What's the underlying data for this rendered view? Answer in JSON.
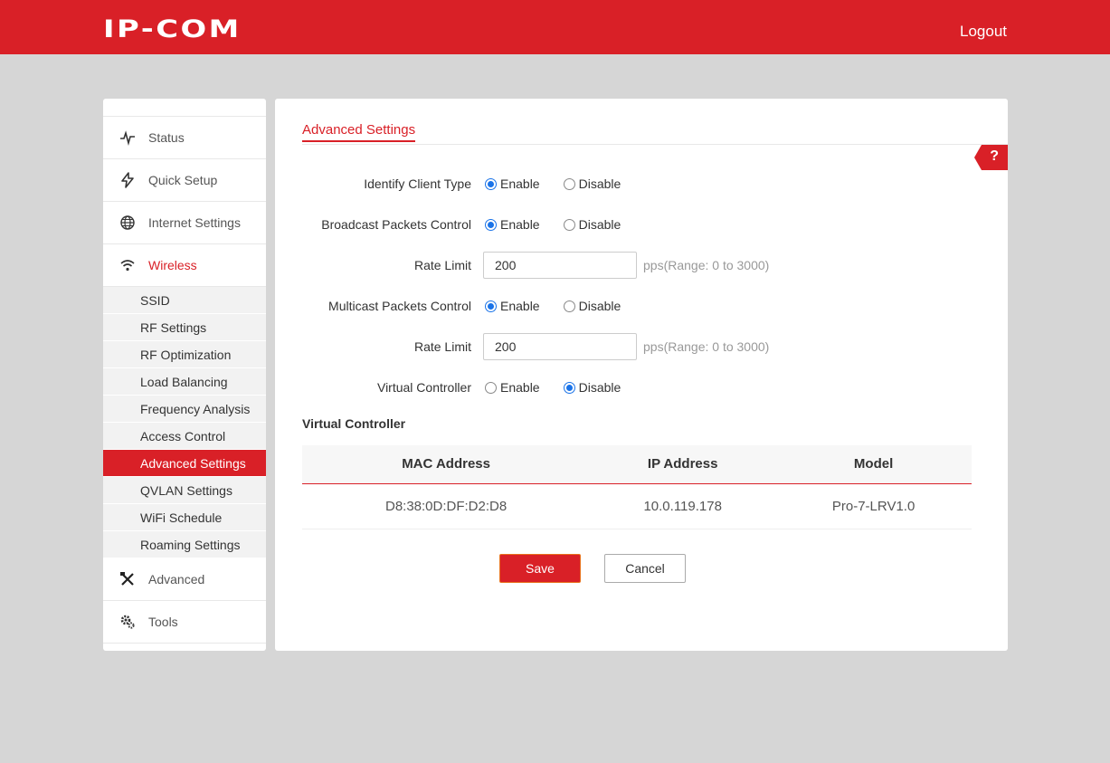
{
  "header": {
    "logo": "IP-COM",
    "logout": "Logout"
  },
  "colors": {
    "brand": "#d92027",
    "radio_selected": "#1a73e8"
  },
  "sidebar": {
    "items": [
      {
        "label": "Status",
        "icon": "pulse-icon"
      },
      {
        "label": "Quick Setup",
        "icon": "lightning-icon"
      },
      {
        "label": "Internet Settings",
        "icon": "globe-icon"
      },
      {
        "label": "Wireless",
        "icon": "wifi-icon",
        "active": true
      }
    ],
    "sub_items": [
      "SSID",
      "RF Settings",
      "RF Optimization",
      "Load Balancing",
      "Frequency Analysis",
      "Access Control",
      "Advanced Settings",
      "QVLAN Settings",
      "WiFi Schedule",
      "Roaming Settings"
    ],
    "active_sub": "Advanced Settings",
    "bottom_items": [
      {
        "label": "Advanced",
        "icon": "tools-icon"
      },
      {
        "label": "Tools",
        "icon": "gears-icon"
      }
    ]
  },
  "main": {
    "tab": "Advanced Settings",
    "help": "?",
    "rows": [
      {
        "label": "Identify Client Type",
        "enable": "Enable",
        "disable": "Disable",
        "selected": "enable"
      },
      {
        "label": "Broadcast Packets Control",
        "enable": "Enable",
        "disable": "Disable",
        "selected": "enable"
      },
      {
        "label": "Rate Limit",
        "value": "200",
        "hint": "pps(Range: 0 to 3000)"
      },
      {
        "label": "Multicast Packets Control",
        "enable": "Enable",
        "disable": "Disable",
        "selected": "enable"
      },
      {
        "label": "Rate Limit",
        "value": "200",
        "hint": "pps(Range: 0 to 3000)"
      },
      {
        "label": "Virtual Controller",
        "enable": "Enable",
        "disable": "Disable",
        "selected": "disable"
      }
    ],
    "section_title": "Virtual Controller",
    "table": {
      "headers": [
        "MAC Address",
        "IP Address",
        "Model"
      ],
      "rows": [
        [
          "D8:38:0D:DF:D2:D8",
          "10.0.119.178",
          "Pro-7-LRV1.0"
        ]
      ]
    },
    "save": "Save",
    "cancel": "Cancel"
  }
}
